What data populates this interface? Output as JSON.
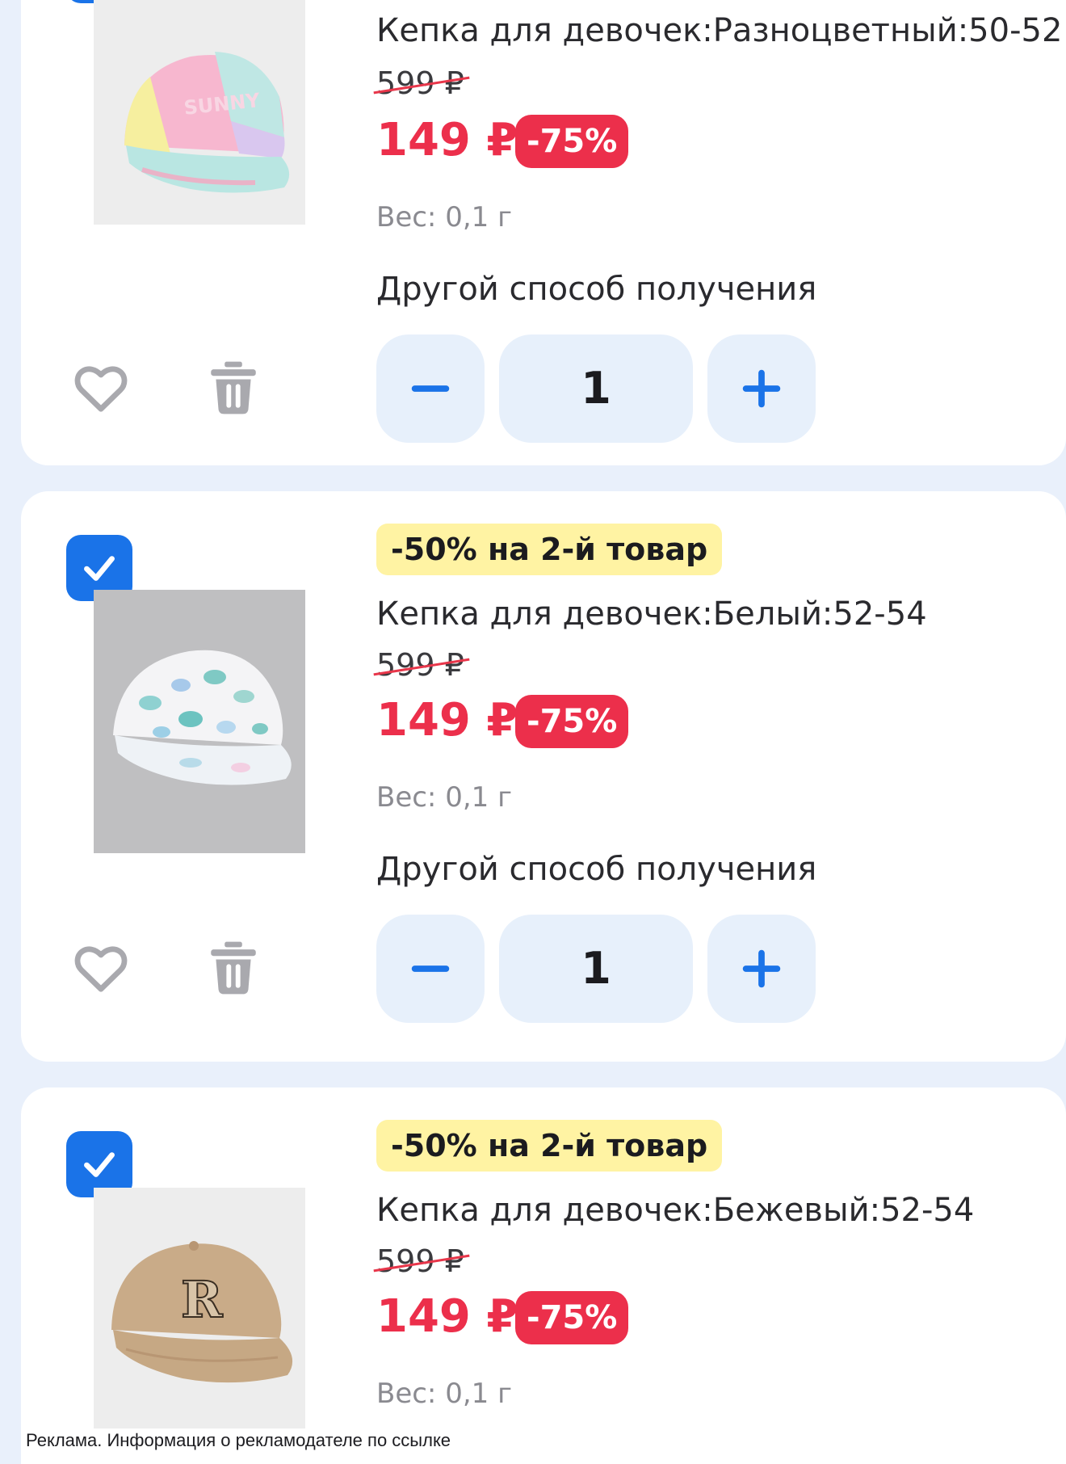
{
  "items": [
    {
      "promo": "",
      "title": "Кепка для девочек:Разноцветный:50-52",
      "old_price": "599 ₽",
      "new_price": "149 ₽",
      "discount": "-75%",
      "weight": "Вес: 0,1 г",
      "delivery": "Другой способ получения",
      "quantity": "1",
      "checked": true,
      "image": "pastel-tie-dye-cap-sunny"
    },
    {
      "promo": "-50% на 2-й товар",
      "title": "Кепка для девочек:Белый:52-54",
      "old_price": "599 ₽",
      "new_price": "149 ₽",
      "discount": "-75%",
      "weight": "Вес: 0,1 г",
      "delivery": "Другой способ получения",
      "quantity": "1",
      "checked": true,
      "image": "white-leopard-print-cap"
    },
    {
      "promo": "-50% на 2-й товар",
      "title": "Кепка для девочек:Бежевый:52-54",
      "old_price": "599 ₽",
      "new_price": "149 ₽",
      "discount": "-75%",
      "weight": "Вес: 0,1 г",
      "checked": true,
      "image": "beige-cap-letter-r"
    }
  ],
  "ad_notice": "Реклама. Информация о рекламодателе по ссылке",
  "colors": {
    "accent": "#1a73e8",
    "price_red": "#ec2f4b",
    "promo_yellow": "#fff3a3",
    "stepper_bg": "#e7f0fb",
    "page_bg": "#e9f0fb"
  },
  "icons": [
    "check-icon",
    "heart-icon",
    "trash-icon",
    "minus-icon",
    "plus-icon"
  ]
}
